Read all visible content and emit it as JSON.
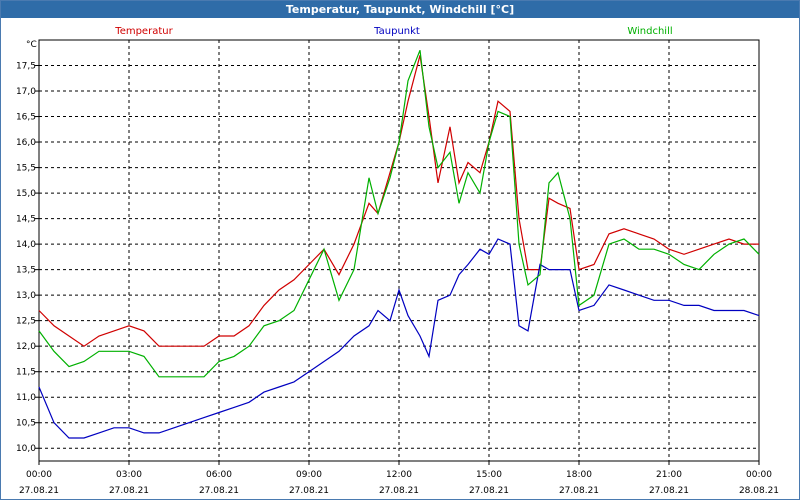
{
  "window": {
    "title": "Temperatur, Taupunkt, Windchill [°C]"
  },
  "chart_data": {
    "type": "line",
    "title": "Temperatur, Taupunkt, Windchill [°C]",
    "ylabel": "°C",
    "ylim": [
      9.75,
      18.0
    ],
    "xlim": [
      0,
      24
    ],
    "grid": true,
    "legend": "top",
    "yticks": [
      10.0,
      10.5,
      11.0,
      11.5,
      12.0,
      12.5,
      13.0,
      13.5,
      14.0,
      14.5,
      15.0,
      15.5,
      16.0,
      16.5,
      17.0,
      17.5
    ],
    "ytick_labels": [
      "10,0",
      "10,5",
      "11,0",
      "11,5",
      "12,0",
      "12,5",
      "13,0",
      "13,5",
      "14,0",
      "14,5",
      "15,0",
      "15,5",
      "16,0",
      "16,5",
      "17,0",
      "17,5"
    ],
    "xticks": [
      0,
      3,
      6,
      9,
      12,
      15,
      18,
      21,
      24
    ],
    "xtick_times": [
      "00:00",
      "03:00",
      "06:00",
      "09:00",
      "12:00",
      "15:00",
      "18:00",
      "21:00",
      "00:00"
    ],
    "xtick_dates": [
      "27.08.21",
      "27.08.21",
      "27.08.21",
      "27.08.21",
      "27.08.21",
      "27.08.21",
      "27.08.21",
      "27.08.21",
      "28.08.21"
    ],
    "series": [
      {
        "name": "Temperatur",
        "color": "#d00000",
        "x": [
          0,
          0.5,
          1,
          1.5,
          2,
          2.5,
          3,
          3.5,
          4,
          4.5,
          5,
          5.5,
          6,
          6.5,
          7,
          7.5,
          8,
          8.5,
          9,
          9.5,
          10,
          10.5,
          11,
          11.3,
          11.7,
          12,
          12.3,
          12.7,
          13,
          13.3,
          13.7,
          14,
          14.3,
          14.7,
          15,
          15.3,
          15.7,
          16,
          16.3,
          16.7,
          17,
          17.3,
          17.7,
          18,
          18.5,
          19,
          19.5,
          20,
          20.5,
          21,
          21.5,
          22,
          22.5,
          23,
          23.5,
          24
        ],
        "values": [
          12.7,
          12.4,
          12.2,
          12.0,
          12.2,
          12.3,
          12.4,
          12.3,
          12.0,
          12.0,
          12.0,
          12.0,
          12.2,
          12.2,
          12.4,
          12.8,
          13.1,
          13.3,
          13.6,
          13.9,
          13.4,
          14.0,
          14.8,
          14.6,
          15.4,
          16.0,
          16.8,
          17.7,
          16.5,
          15.2,
          16.3,
          15.2,
          15.6,
          15.4,
          16.0,
          16.8,
          16.6,
          14.5,
          13.5,
          13.5,
          14.9,
          14.8,
          14.7,
          13.5,
          13.6,
          14.2,
          14.3,
          14.2,
          14.1,
          13.9,
          13.8,
          13.9,
          14.0,
          14.1,
          14.0,
          14.0
        ]
      },
      {
        "name": "Taupunkt",
        "color": "#0000c0",
        "x": [
          0,
          0.5,
          1,
          1.5,
          2,
          2.5,
          3,
          3.5,
          4,
          4.5,
          5,
          5.5,
          6,
          6.5,
          7,
          7.5,
          8,
          8.5,
          9,
          9.5,
          10,
          10.5,
          11,
          11.3,
          11.7,
          12,
          12.3,
          12.7,
          13,
          13.3,
          13.7,
          14,
          14.3,
          14.7,
          15,
          15.3,
          15.7,
          16,
          16.3,
          16.7,
          17,
          17.3,
          17.7,
          18,
          18.5,
          19,
          19.5,
          20,
          20.5,
          21,
          21.5,
          22,
          22.5,
          23,
          23.5,
          24
        ],
        "values": [
          11.2,
          10.5,
          10.2,
          10.2,
          10.3,
          10.4,
          10.4,
          10.3,
          10.3,
          10.4,
          10.5,
          10.6,
          10.7,
          10.8,
          10.9,
          11.1,
          11.2,
          11.3,
          11.5,
          11.7,
          11.9,
          12.2,
          12.4,
          12.7,
          12.5,
          13.1,
          12.6,
          12.2,
          11.8,
          12.9,
          13.0,
          13.4,
          13.6,
          13.9,
          13.8,
          14.1,
          14.0,
          12.4,
          12.3,
          13.6,
          13.5,
          13.5,
          13.5,
          12.7,
          12.8,
          13.2,
          13.1,
          13.0,
          12.9,
          12.9,
          12.8,
          12.8,
          12.7,
          12.7,
          12.7,
          12.6
        ]
      },
      {
        "name": "Windchill",
        "color": "#00b000",
        "x": [
          0,
          0.5,
          1,
          1.5,
          2,
          2.5,
          3,
          3.5,
          4,
          4.5,
          5,
          5.5,
          6,
          6.5,
          7,
          7.5,
          8,
          8.5,
          9,
          9.5,
          10,
          10.5,
          11,
          11.3,
          11.7,
          12,
          12.3,
          12.7,
          13,
          13.3,
          13.7,
          14,
          14.3,
          14.7,
          15,
          15.3,
          15.7,
          16,
          16.3,
          16.7,
          17,
          17.3,
          17.7,
          18,
          18.5,
          19,
          19.5,
          20,
          20.5,
          21,
          21.5,
          22,
          22.5,
          23,
          23.5,
          24
        ],
        "values": [
          12.3,
          11.9,
          11.6,
          11.7,
          11.9,
          11.9,
          11.9,
          11.8,
          11.4,
          11.4,
          11.4,
          11.4,
          11.7,
          11.8,
          12.0,
          12.4,
          12.5,
          12.7,
          13.3,
          13.9,
          12.9,
          13.5,
          15.3,
          14.6,
          15.3,
          16.0,
          17.2,
          17.8,
          16.3,
          15.5,
          15.8,
          14.8,
          15.4,
          15.0,
          16.0,
          16.6,
          16.5,
          14.0,
          13.2,
          13.4,
          15.2,
          15.4,
          14.5,
          12.8,
          13.0,
          14.0,
          14.1,
          13.9,
          13.9,
          13.8,
          13.6,
          13.5,
          13.8,
          14.0,
          14.1,
          13.8
        ]
      }
    ]
  }
}
